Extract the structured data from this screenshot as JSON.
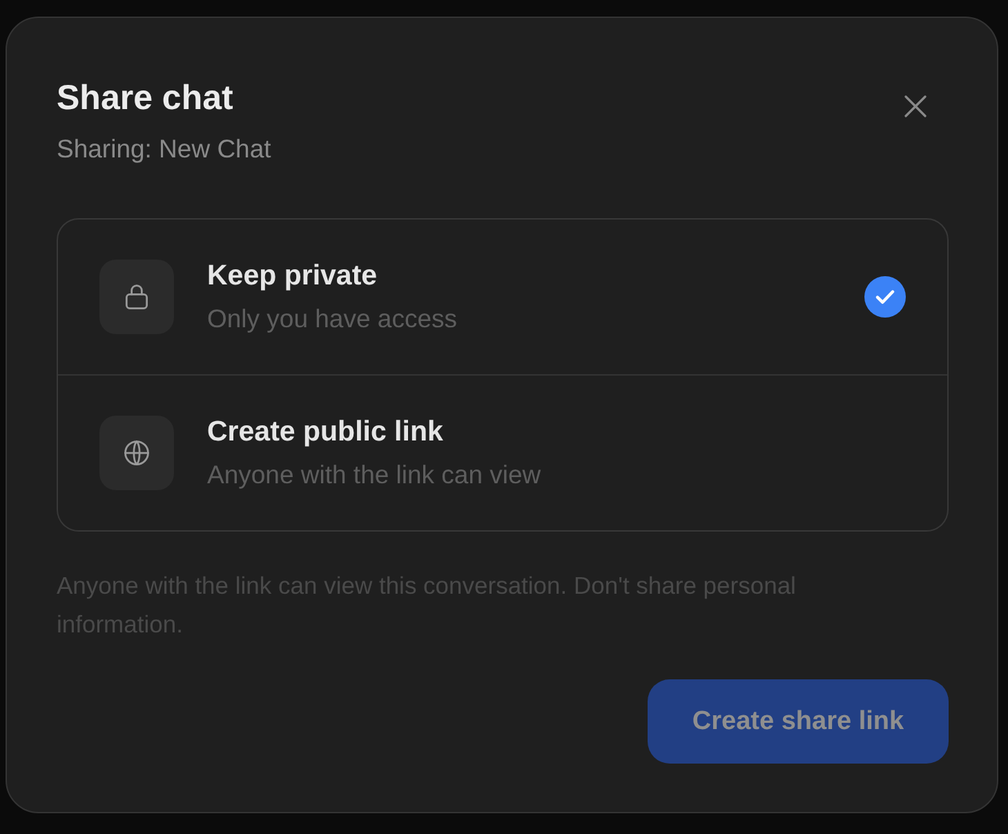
{
  "dialog": {
    "title": "Share chat",
    "subtitle": "Sharing: New Chat"
  },
  "options": [
    {
      "kind": "private",
      "title": "Keep private",
      "description": "Only you have access",
      "selected": true
    },
    {
      "kind": "public",
      "title": "Create public link",
      "description": "Anyone with the link can view",
      "selected": false
    }
  ],
  "note": "Anyone with the link can view this conversation. Don't share personal information.",
  "primary_button": {
    "label": "Create share link",
    "disabled": true
  }
}
